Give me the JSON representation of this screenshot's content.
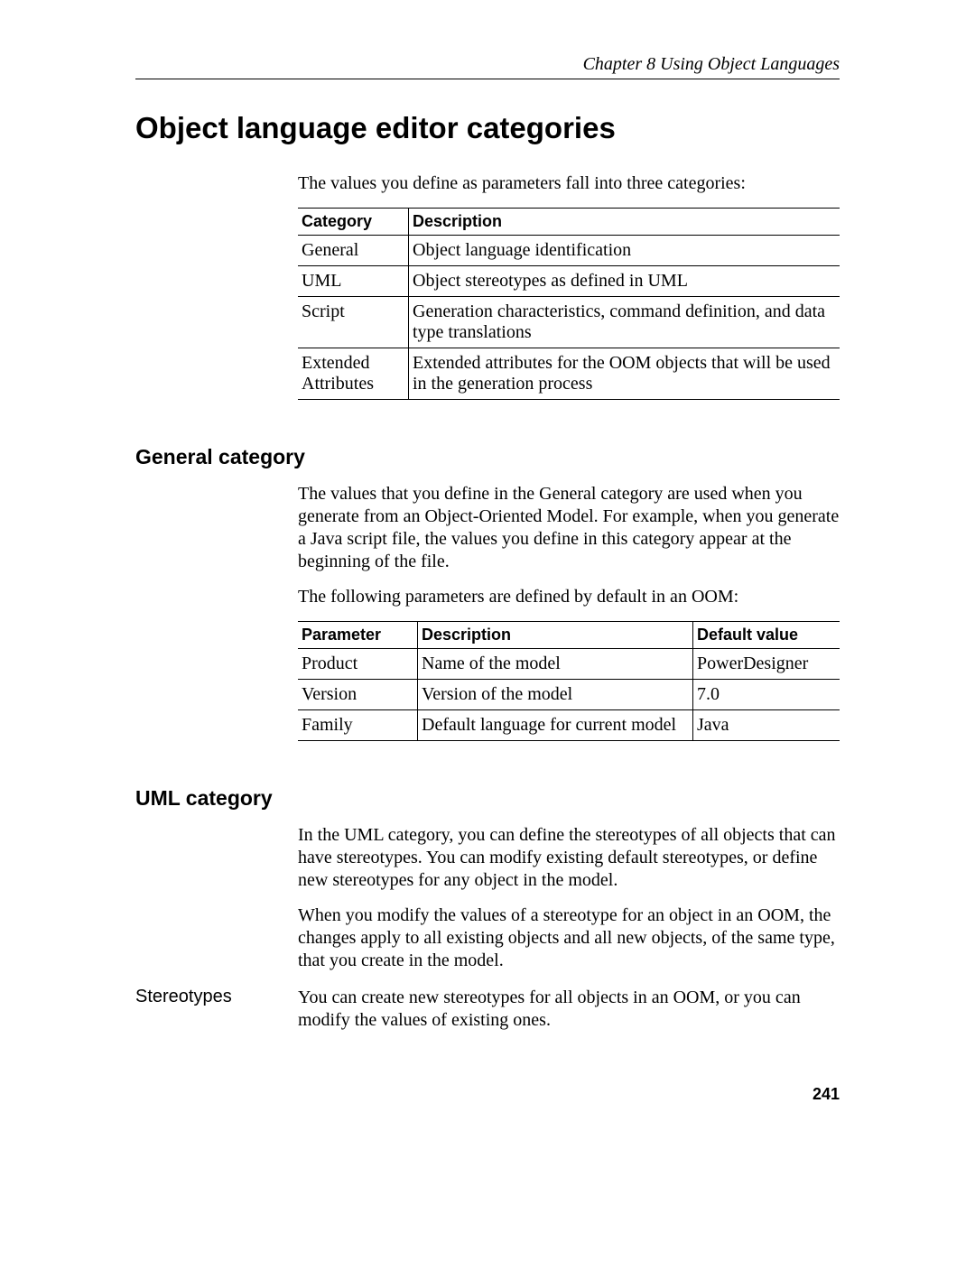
{
  "header": {
    "chapter": "Chapter 8  Using Object Languages"
  },
  "title": "Object language editor categories",
  "intro": "The values you define as parameters fall into three categories:",
  "table1": {
    "headers": {
      "c1": "Category",
      "c2": "Description"
    },
    "rows": [
      {
        "c1": "General",
        "c2": "Object language identification"
      },
      {
        "c1": "UML",
        "c2": "Object stereotypes as defined in UML"
      },
      {
        "c1": "Script",
        "c2": "Generation characteristics, command definition, and data type translations"
      },
      {
        "c1": "Extended Attributes",
        "c2": "Extended attributes for the OOM objects that will be used in the generation process"
      }
    ]
  },
  "general": {
    "heading": "General category",
    "p1": "The values that you define in the General category are used when you generate from an Object-Oriented Model. For example, when you generate a Java script file, the values you define in this category appear at the beginning of the file.",
    "p2": "The following parameters are defined by default in an OOM:",
    "table": {
      "headers": {
        "c1": "Parameter",
        "c2": "Description",
        "c3": "Default value"
      },
      "rows": [
        {
          "c1": "Product",
          "c2": "Name of the model",
          "c3": "PowerDesigner"
        },
        {
          "c1": "Version",
          "c2": "Version of the model",
          "c3": "7.0"
        },
        {
          "c1": "Family",
          "c2": "Default language for current model",
          "c3": "Java"
        }
      ]
    }
  },
  "uml": {
    "heading": "UML category",
    "p1": "In the UML category, you can define the stereotypes of all objects that can have stereotypes. You can modify existing default stereotypes, or define new stereotypes for any object in the model.",
    "p2": "When you modify the values of a stereotype for an object in an OOM, the changes apply to all existing objects and all new objects, of the same type, that you create in the model.",
    "marginLabel": "Stereotypes",
    "p3": "You can create new stereotypes for all objects in an OOM, or you can modify the values of existing ones."
  },
  "pageNumber": "241"
}
